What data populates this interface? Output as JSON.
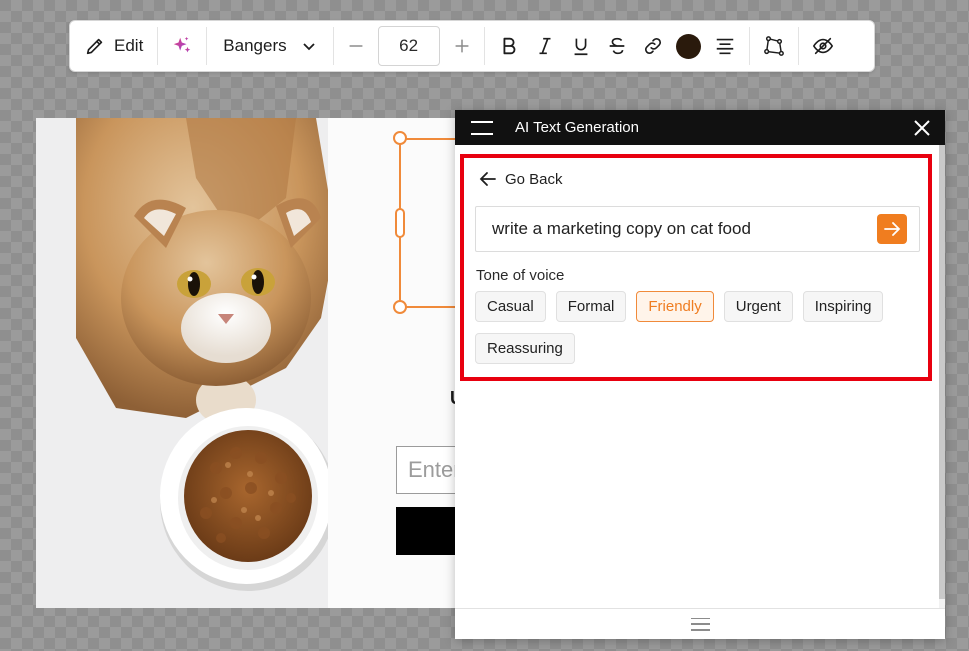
{
  "toolbar": {
    "edit_label": "Edit",
    "font_name": "Bangers",
    "font_size": "62",
    "text_color": "#2a1a0c",
    "icons": [
      "pencil-icon",
      "sparkle-icon",
      "chevron-down-icon",
      "minus-icon",
      "plus-icon",
      "bold-icon",
      "italic-icon",
      "underline-icon",
      "strikethrough-icon",
      "link-icon",
      "align-center-icon",
      "shape-icon",
      "eye-off-icon"
    ]
  },
  "canvas": {
    "email_placeholder": "Enter",
    "partial_heading": "U"
  },
  "ai_panel": {
    "title": "AI Text Generation",
    "back_label": "Go Back",
    "prompt": "write a marketing copy on cat food",
    "tone_label": "Tone of voice",
    "tones": [
      "Casual",
      "Formal",
      "Friendly",
      "Urgent",
      "Inspiring",
      "Reassuring"
    ],
    "selected_tone": "Friendly",
    "accent_color": "#f07d1f",
    "highlight_color": "#e8000f"
  }
}
